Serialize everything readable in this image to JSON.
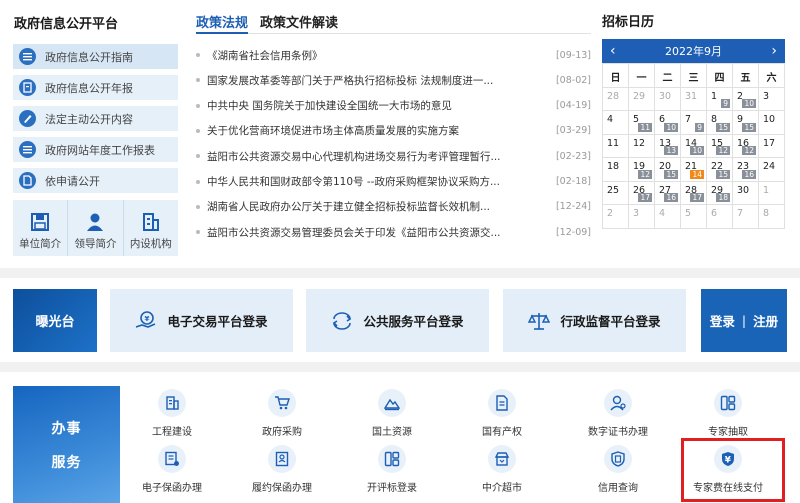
{
  "left_panel": {
    "title": "政府信息公开平台",
    "items": [
      {
        "label": "政府信息公开指南",
        "icon": "list-icon"
      },
      {
        "label": "政府信息公开年报",
        "icon": "report-icon"
      },
      {
        "label": "法定主动公开内容",
        "icon": "pen-icon"
      },
      {
        "label": "政府网站年度工作报表",
        "icon": "list-icon"
      },
      {
        "label": "依申请公开",
        "icon": "document-icon"
      }
    ],
    "org": [
      {
        "label": "单位简介",
        "icon": "save-icon"
      },
      {
        "label": "领导简介",
        "icon": "person-icon"
      },
      {
        "label": "内设机构",
        "icon": "building-icon"
      }
    ]
  },
  "news": {
    "tabs": [
      "政策法规",
      "政策文件解读"
    ],
    "items": [
      {
        "title": "《湖南省社会信用条例》",
        "date": "[09-13]"
      },
      {
        "title": "国家发展改革委等部门关于严格执行招标投标 法规制度进一...",
        "date": "[08-02]"
      },
      {
        "title": "中共中央 国务院关于加快建设全国统一大市场的意见",
        "date": "[04-19]"
      },
      {
        "title": "关于优化营商环境促进市场主体高质量发展的实施方案",
        "date": "[03-29]"
      },
      {
        "title": "益阳市公共资源交易中心代理机构进场交易行为考评管理暂行...",
        "date": "[02-23]"
      },
      {
        "title": "中华人民共和国财政部令第110号 --政府采购框架协议采购方...",
        "date": "[02-18]"
      },
      {
        "title": "湖南省人民政府办公厅关于建立健全招标投标监督长效机制...",
        "date": "[12-24]"
      },
      {
        "title": "益阳市公共资源交易管理委员会关于印发《益阳市公共资源交...",
        "date": "[12-09]"
      }
    ]
  },
  "calendar": {
    "title": "招标日历",
    "month": "2022年9月",
    "prev": "‹",
    "next": "›",
    "weekdays": [
      "日",
      "一",
      "二",
      "三",
      "四",
      "五",
      "六"
    ],
    "rows": [
      [
        {
          "d": "28",
          "dim": true
        },
        {
          "d": "29",
          "dim": true
        },
        {
          "d": "30",
          "dim": true
        },
        {
          "d": "31",
          "dim": true
        },
        {
          "d": "1",
          "b": "9"
        },
        {
          "d": "2",
          "b": "10"
        },
        {
          "d": "3"
        }
      ],
      [
        {
          "d": "4"
        },
        {
          "d": "5",
          "b": "11"
        },
        {
          "d": "6",
          "b": "10"
        },
        {
          "d": "7",
          "b": "9"
        },
        {
          "d": "8",
          "b": "15"
        },
        {
          "d": "9",
          "b": "15"
        },
        {
          "d": "10"
        }
      ],
      [
        {
          "d": "11"
        },
        {
          "d": "12"
        },
        {
          "d": "13",
          "b": "13"
        },
        {
          "d": "14",
          "b": "10"
        },
        {
          "d": "15",
          "b": "12"
        },
        {
          "d": "16",
          "b": "12"
        },
        {
          "d": "17"
        }
      ],
      [
        {
          "d": "18"
        },
        {
          "d": "19",
          "b": "12"
        },
        {
          "d": "20",
          "b": "15"
        },
        {
          "d": "21",
          "b": "14",
          "o": true
        },
        {
          "d": "22",
          "b": "15"
        },
        {
          "d": "23",
          "b": "16"
        },
        {
          "d": "24"
        }
      ],
      [
        {
          "d": "25"
        },
        {
          "d": "26",
          "b": "17"
        },
        {
          "d": "27",
          "b": "16"
        },
        {
          "d": "28",
          "b": "17"
        },
        {
          "d": "29",
          "b": "18"
        },
        {
          "d": "30"
        },
        {
          "d": "1",
          "dim": true
        }
      ],
      [
        {
          "d": "2",
          "dim": true
        },
        {
          "d": "3",
          "dim": true
        },
        {
          "d": "4",
          "dim": true
        },
        {
          "d": "5",
          "dim": true
        },
        {
          "d": "6",
          "dim": true
        },
        {
          "d": "7",
          "dim": true
        },
        {
          "d": "8",
          "dim": true
        }
      ]
    ]
  },
  "banner": {
    "exposure": "曝光台",
    "platforms": [
      {
        "label": "电子交易平台登录",
        "icon": "yen-hand-icon"
      },
      {
        "label": "公共服务平台登录",
        "icon": "exchange-icon"
      },
      {
        "label": "行政监督平台登录",
        "icon": "scale-icon"
      }
    ],
    "login": "登录",
    "separator": "|",
    "register": "注册"
  },
  "services": {
    "title_line1": "办事",
    "title_line2": "服务",
    "row1": [
      {
        "label": "工程建设",
        "icon": "building-icon"
      },
      {
        "label": "政府采购",
        "icon": "cart-icon"
      },
      {
        "label": "国土资源",
        "icon": "land-icon"
      },
      {
        "label": "国有产权",
        "icon": "document-icon"
      },
      {
        "label": "数字证书办理",
        "icon": "certificate-icon"
      },
      {
        "label": "专家抽取",
        "icon": "grid-icon"
      }
    ],
    "row2": [
      {
        "label": "电子保函办理",
        "icon": "guarantee-icon"
      },
      {
        "label": "履约保函办理",
        "icon": "contract-icon"
      },
      {
        "label": "开评标登录",
        "icon": "grid-icon"
      },
      {
        "label": "中介超市",
        "icon": "shop-icon"
      },
      {
        "label": "信用查询",
        "icon": "shield-icon"
      },
      {
        "label": "专家费在线支付",
        "icon": "yen-shield-icon"
      }
    ]
  }
}
